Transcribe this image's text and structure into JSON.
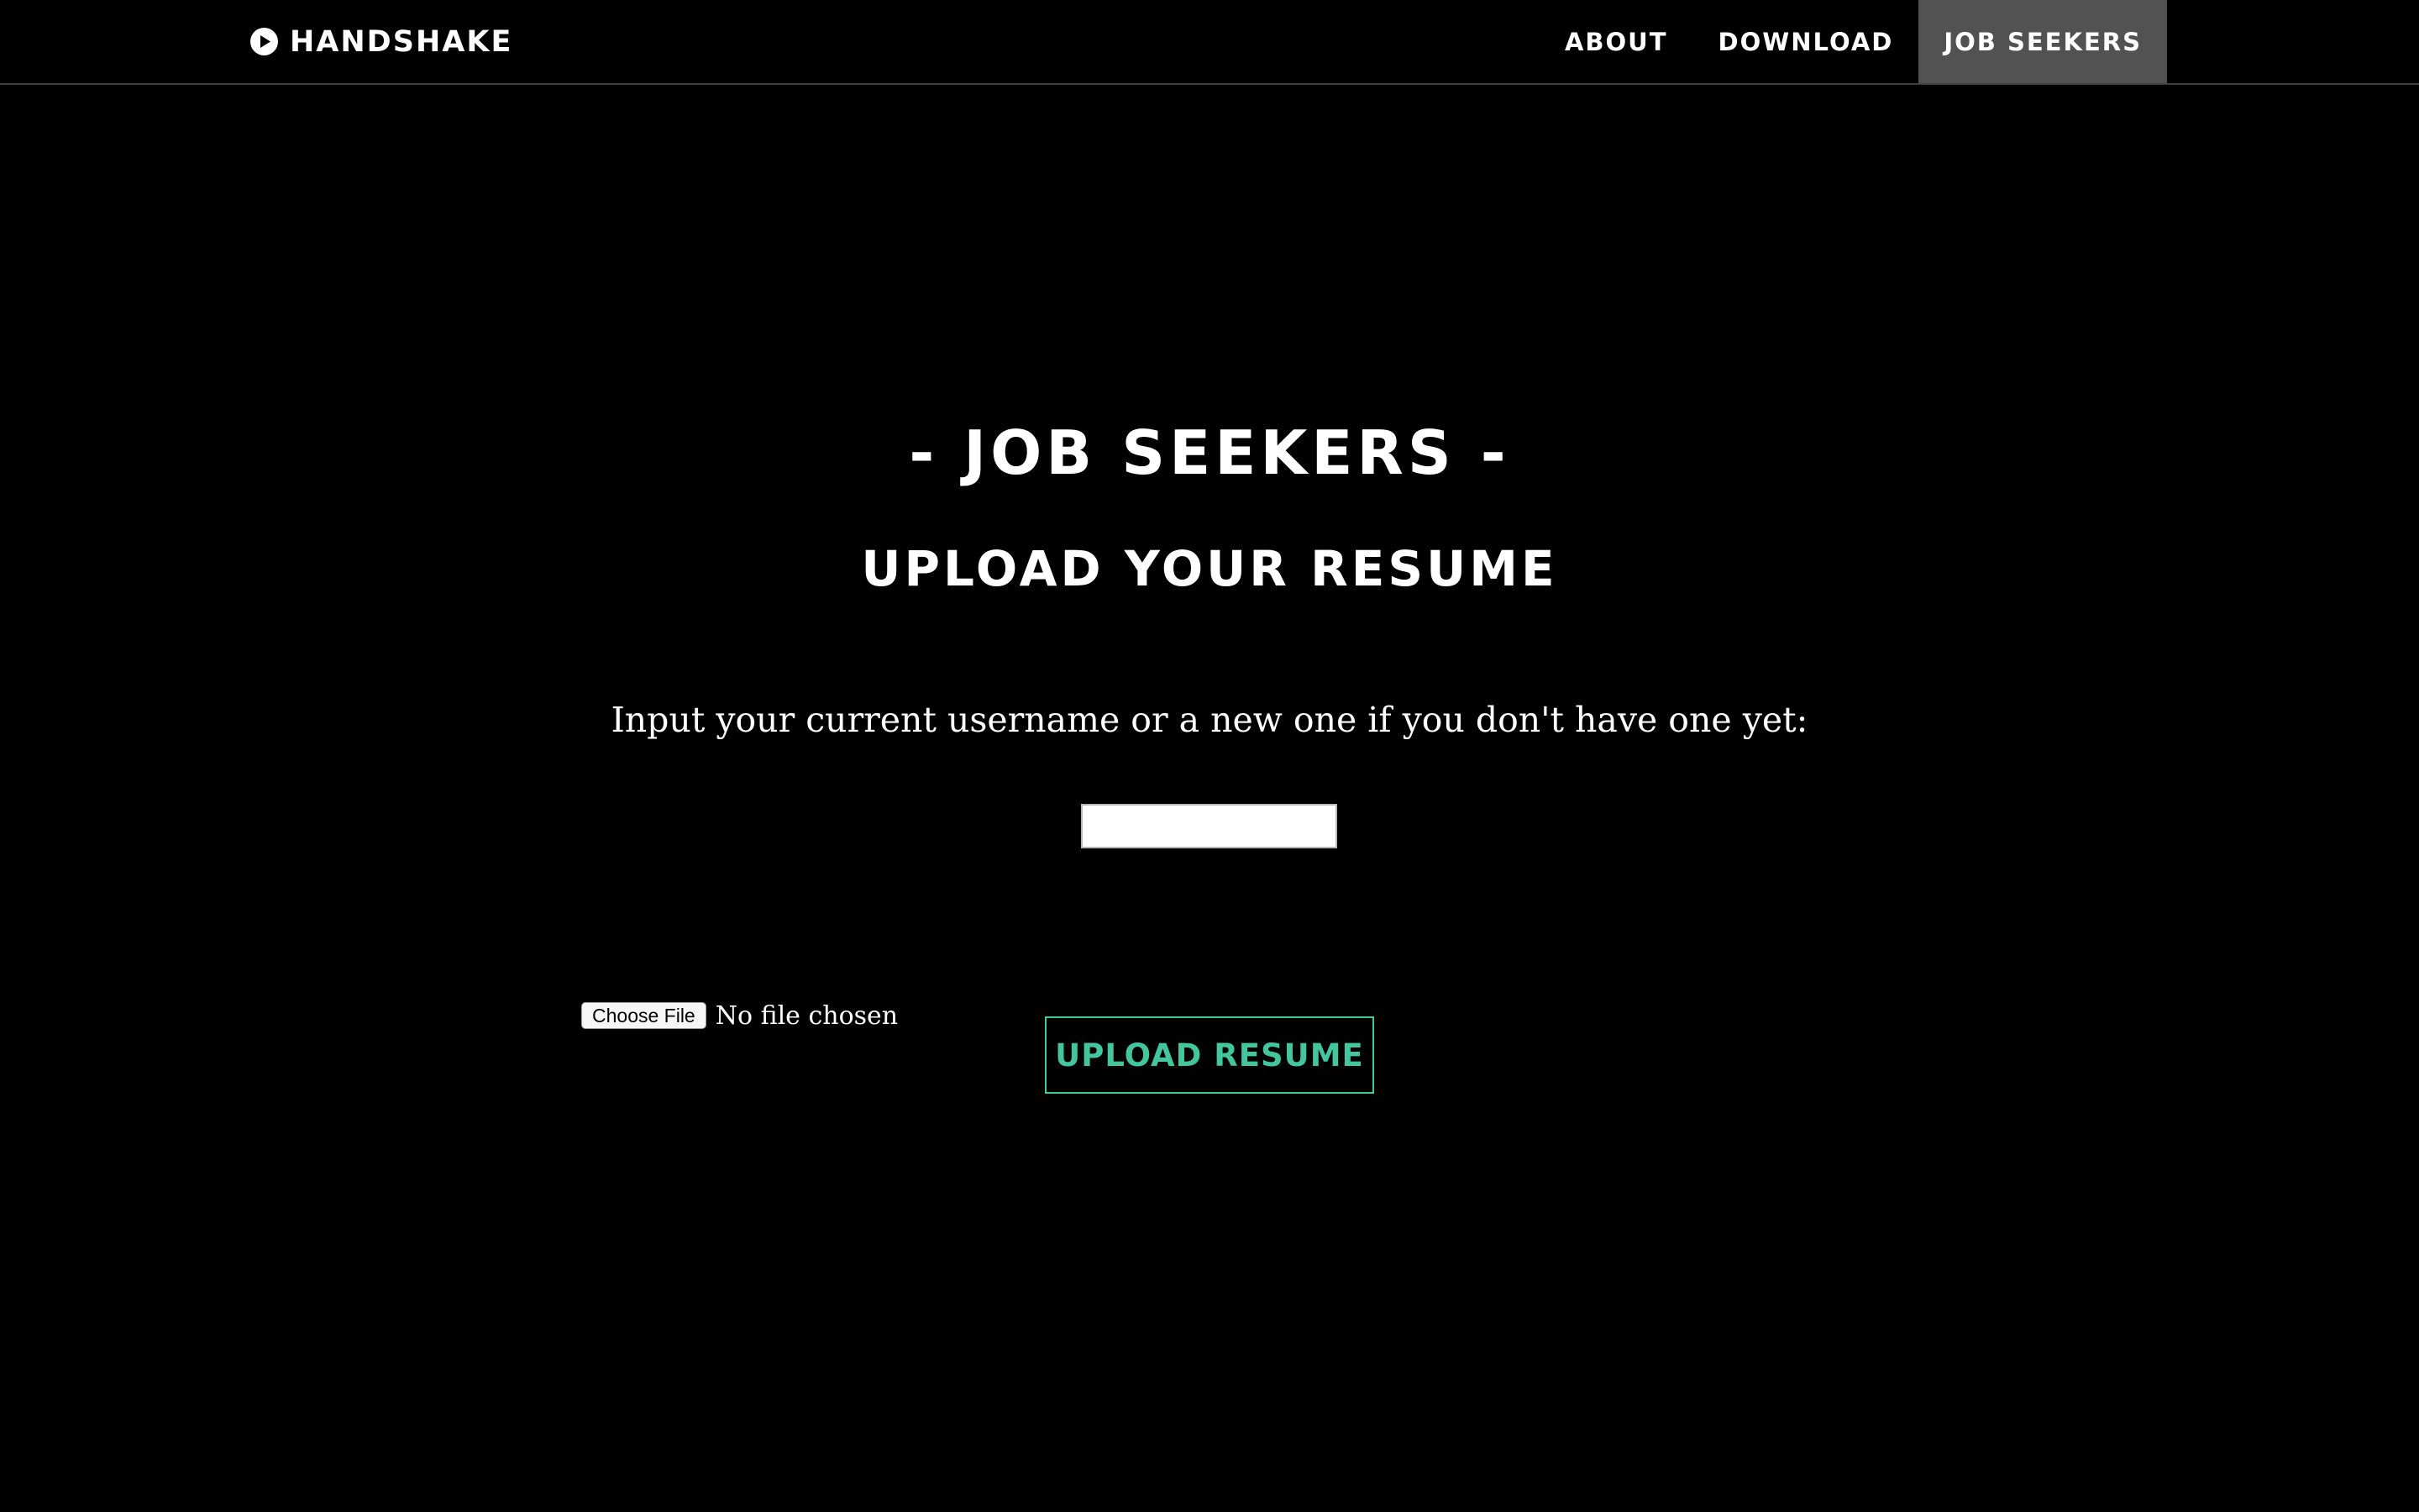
{
  "brand": {
    "name_bold": "HAND",
    "name_light": "SHAKE",
    "icon": "play-circle-icon"
  },
  "nav": {
    "items": [
      {
        "label": "ABOUT",
        "active": false
      },
      {
        "label": "DOWNLOAD",
        "active": false
      },
      {
        "label": "JOB SEEKERS",
        "active": true
      }
    ]
  },
  "main": {
    "title": "- JOB SEEKERS -",
    "subtitle": "UPLOAD YOUR RESUME",
    "prompt": "Input your current username or a new one if you don't have one yet:",
    "username": {
      "value": "",
      "placeholder": ""
    },
    "file": {
      "button_label": "Choose File",
      "status": "No file chosen"
    },
    "submit_label": "UPLOAD RESUME"
  },
  "colors": {
    "background": "#000000",
    "text": "#ffffff",
    "nav_active_bg": "#525252",
    "accent": "#43c59e"
  }
}
